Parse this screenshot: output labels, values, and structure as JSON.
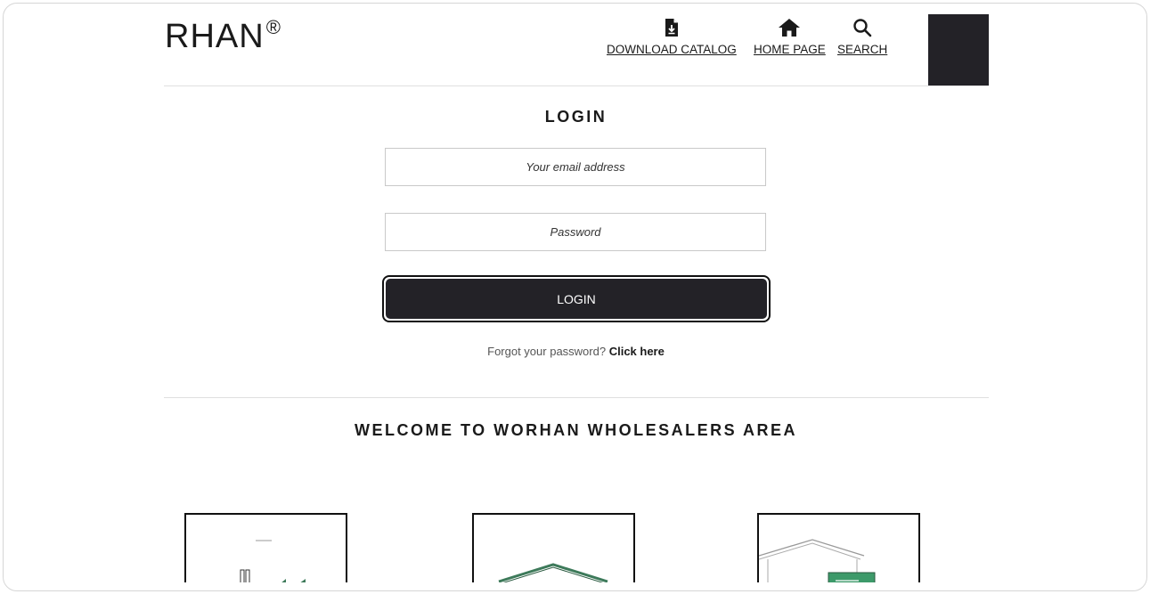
{
  "header": {
    "logo_text": "RHAN",
    "logo_mark": "®",
    "nav": [
      {
        "label": "DOWNLOAD CATALOG",
        "icon": "download-file-icon"
      },
      {
        "label": "HOME PAGE",
        "icon": "home-icon"
      },
      {
        "label": "SEARCH",
        "icon": "search-icon"
      }
    ]
  },
  "login": {
    "title": "LOGIN",
    "email_placeholder": "Your email address",
    "password_placeholder": "Password",
    "button_label": "LOGIN",
    "forgot_text": "Forgot your password?",
    "forgot_link": "Click here"
  },
  "welcome": {
    "title": "WELCOME TO WORHAN WHOLESALERS AREA"
  },
  "colors": {
    "dark": "#232227",
    "accent_green": "#3d7a5a"
  }
}
